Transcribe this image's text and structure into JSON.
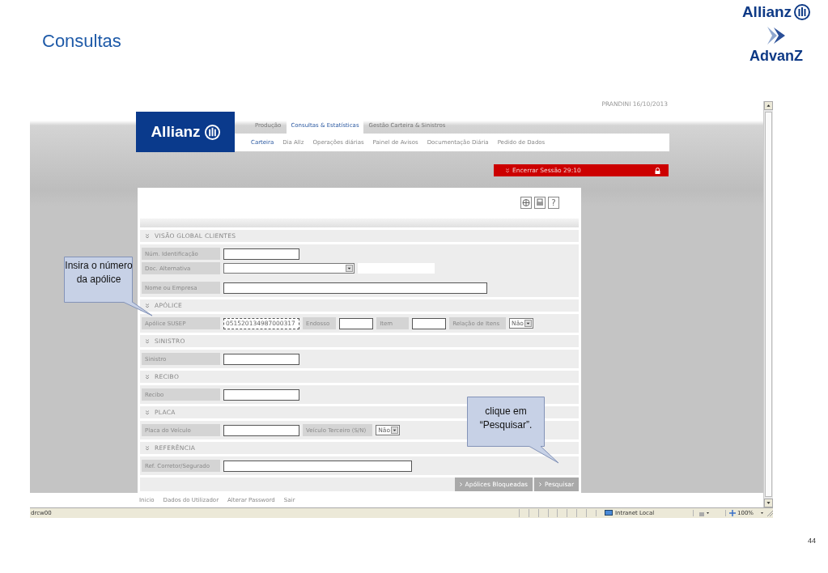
{
  "slide": {
    "title": "Consultas",
    "page_number": "44"
  },
  "logo": {
    "brand": "Allianz",
    "product": "AdvanZ"
  },
  "browser": {
    "user_info": "PRANDINI 16/10/2013",
    "site_logo": "Allianz",
    "main_menu": [
      {
        "label": "Produção",
        "selected": false
      },
      {
        "label": "Consultas & Estatísticas",
        "selected": true
      },
      {
        "label": "Gestão Carteira & Sinistros",
        "selected": false
      }
    ],
    "sub_menu": [
      {
        "label": "Carteira",
        "selected": true
      },
      {
        "label": "Dia Allz",
        "selected": false
      },
      {
        "label": "Operações diárias",
        "selected": false
      },
      {
        "label": "Painel de Avisos",
        "selected": false
      },
      {
        "label": "Documentação Diária",
        "selected": false
      },
      {
        "label": "Pedido de Dados",
        "selected": false
      }
    ],
    "session_bar": {
      "text": "Encerrar Sessão 29:10"
    },
    "help_label": "?",
    "sections": [
      {
        "title": "VISÃO GLOBAL CLIENTES",
        "rows": [
          {
            "items": [
              {
                "kind": "label",
                "text": "Núm. Identificação"
              },
              {
                "kind": "input",
                "focused": false
              }
            ]
          },
          {
            "items": [
              {
                "kind": "label",
                "text": "Doc. Alternativa"
              },
              {
                "kind": "select"
              },
              {
                "kind": "blank"
              }
            ]
          },
          {
            "items": [
              {
                "kind": "label",
                "text": "Nome ou Empresa"
              },
              {
                "kind": "input",
                "focused": false
              }
            ]
          }
        ]
      },
      {
        "title": "APÓLICE",
        "rows": [
          {
            "items": [
              {
                "kind": "label",
                "text": "Apólice SUSEP"
              },
              {
                "kind": "input",
                "value": "051520134987000317",
                "focused": true
              },
              {
                "kind": "sublabel",
                "text": "Endosso"
              },
              {
                "kind": "input",
                "focused": false
              },
              {
                "kind": "sublabel",
                "text": "Item"
              },
              {
                "kind": "input",
                "focused": false
              },
              {
                "kind": "sublabel",
                "text": "Relação de Itens"
              },
              {
                "kind": "select",
                "value": "Não"
              }
            ]
          }
        ]
      },
      {
        "title": "SINISTRO",
        "rows": [
          {
            "items": [
              {
                "kind": "label",
                "text": "Sinistro"
              },
              {
                "kind": "input",
                "focused": false
              }
            ]
          }
        ]
      },
      {
        "title": "RECIBO",
        "rows": [
          {
            "items": [
              {
                "kind": "label",
                "text": "Recibo"
              },
              {
                "kind": "input",
                "focused": false
              }
            ]
          }
        ]
      },
      {
        "title": "PLACA",
        "rows": [
          {
            "items": [
              {
                "kind": "label",
                "text": "Placa do Veículo"
              },
              {
                "kind": "input",
                "focused": false
              },
              {
                "kind": "sublabel",
                "text": "Veículo Terceiro (S/N)"
              },
              {
                "kind": "select",
                "value": "Não"
              }
            ]
          }
        ]
      },
      {
        "title": "REFERÊNCIA",
        "rows": [
          {
            "items": [
              {
                "kind": "label",
                "text": "Ref. Corretor/Segurado"
              },
              {
                "kind": "input",
                "focused": false
              }
            ]
          }
        ]
      }
    ],
    "buttons": [
      {
        "label": "Apólices Bloqueadas"
      },
      {
        "label": "Pesquisar"
      }
    ],
    "footer_links": [
      "Inicio",
      "Dados do Utilizador",
      "Alterar Password",
      "Sair"
    ],
    "status_bar": {
      "left": "drcw00",
      "zone": "Intranet Local",
      "zoom": "100%"
    }
  },
  "callouts": [
    {
      "text": "Insira o número da apólice",
      "kind": "left"
    },
    {
      "text": "clique em “Pesquisar”.",
      "kind": "right"
    }
  ]
}
